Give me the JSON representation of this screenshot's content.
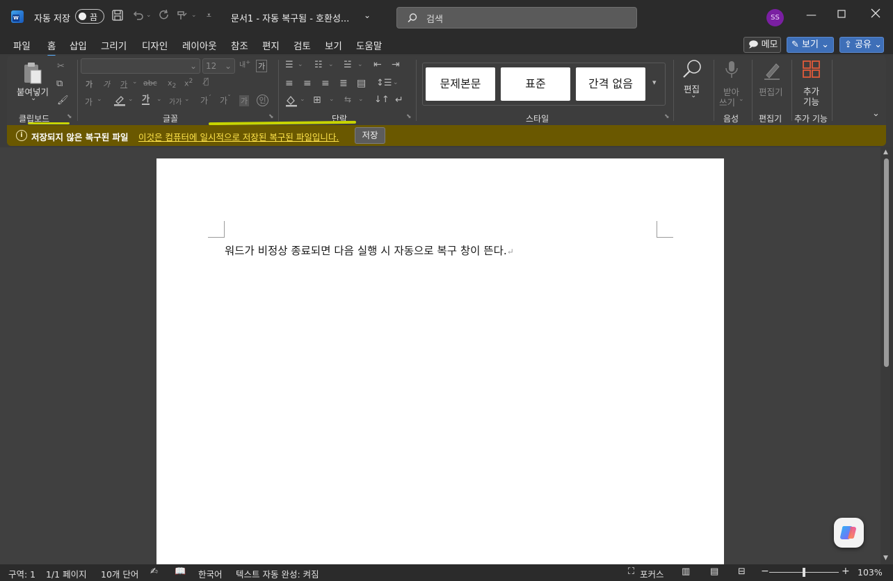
{
  "titlebar": {
    "autosave_label": "자동 저장",
    "autosave_state": "끔",
    "doc_title": "문서1  -  자동 복구됨  -  호환성...",
    "search_placeholder": "검색",
    "avatar_initials": "SS"
  },
  "menu": {
    "tabs": [
      "파일",
      "홈",
      "삽입",
      "그리기",
      "디자인",
      "레이아웃",
      "참조",
      "편지",
      "검토",
      "보기",
      "도움말"
    ],
    "active_tab": "홈",
    "memo_button": "메모",
    "view_button": "보기",
    "share_button": "공유"
  },
  "ribbon": {
    "clipboard": {
      "paste_label": "붙여넣기",
      "group_label": "클립보드"
    },
    "font": {
      "font_size": "12",
      "group_label": "글꼴",
      "glyph_a": "가",
      "glyph_gaga": "가가"
    },
    "paragraph": {
      "group_label": "단락"
    },
    "styles": {
      "items": [
        "문제본문",
        "표준",
        "간격 없음"
      ],
      "group_label": "스타일"
    },
    "editing": {
      "label": "편집"
    },
    "voice": {
      "dictate_label_1": "받아",
      "dictate_label_2": "쓰기",
      "group_label": "음성"
    },
    "editor": {
      "label": "편집기",
      "group_label": "편집기"
    },
    "addins": {
      "label_1": "추가",
      "label_2": "기능",
      "group_label": "추가 기능"
    }
  },
  "infobar": {
    "title": "저장되지 않은 복구된 파일",
    "message": "이것은 컴퓨터에 일시적으로 저장된 복구된 파일입니다.",
    "save_button": "저장"
  },
  "document": {
    "text": "워드가 비정상 종료되면 다음 실행 시 자동으로 복구 창이 뜬다."
  },
  "statusbar": {
    "section": "구역: 1",
    "page": "1/1 페이지",
    "words": "10개 단어",
    "language": "한국어",
    "autocomplete": "텍스트 자동 완성: 켜짐",
    "focus": "포커스",
    "zoom": "103%"
  },
  "colors": {
    "accent": "#5ab0ff",
    "infobar_bg": "#6a5800",
    "info_link": "#ffe44a",
    "avatar": "#7a1fa2"
  }
}
